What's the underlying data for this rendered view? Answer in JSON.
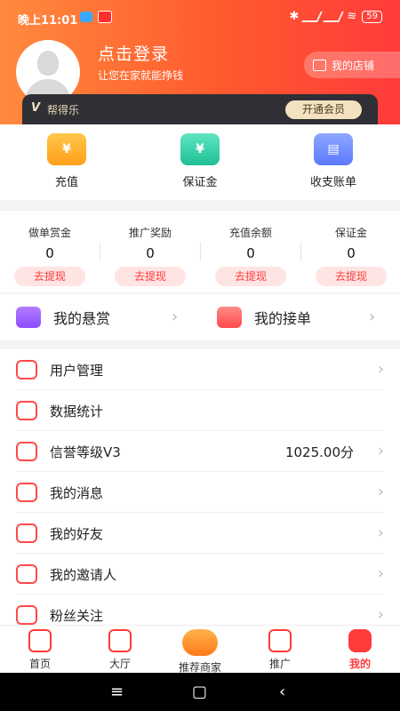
{
  "status_bar": {
    "time": "晚上11:01",
    "battery": "59"
  },
  "profile": {
    "title": "点击登录",
    "subtitle": "让您在家就能挣钱",
    "shop_button": "我的店铺"
  },
  "vip": {
    "logo": "V",
    "brand": "帮得乐",
    "button": "开通会员"
  },
  "functions": [
    {
      "label": "充值",
      "icon": "wallet-icon"
    },
    {
      "label": "保证金",
      "icon": "shield-yen-icon"
    },
    {
      "label": "收支账单",
      "icon": "bill-icon"
    }
  ],
  "stats": [
    {
      "title": "做单赏金",
      "value": "0",
      "action": "去提现"
    },
    {
      "title": "推广奖励",
      "value": "0",
      "action": "去提现"
    },
    {
      "title": "充值余额",
      "value": "0",
      "action": "去提现"
    },
    {
      "title": "保证金",
      "value": "0",
      "action": "去提现"
    }
  ],
  "bounty": {
    "my_bounty": "我的悬赏",
    "my_orders": "我的接单"
  },
  "menu": [
    {
      "label": "用户管理",
      "value": ""
    },
    {
      "label": "数据统计",
      "value": ""
    },
    {
      "label": "信誉等级V3",
      "value": "1025.00分"
    },
    {
      "label": "我的消息",
      "value": ""
    },
    {
      "label": "我的好友",
      "value": ""
    },
    {
      "label": "我的邀请人",
      "value": ""
    },
    {
      "label": "粉丝关注",
      "value": ""
    }
  ],
  "bottom_nav": [
    {
      "label": "首页"
    },
    {
      "label": "大厅"
    },
    {
      "label": "推荐商家"
    },
    {
      "label": "推广"
    },
    {
      "label": "我的"
    }
  ],
  "system_nav": {
    "menu": "≡",
    "home": "▢",
    "back": "‹"
  }
}
